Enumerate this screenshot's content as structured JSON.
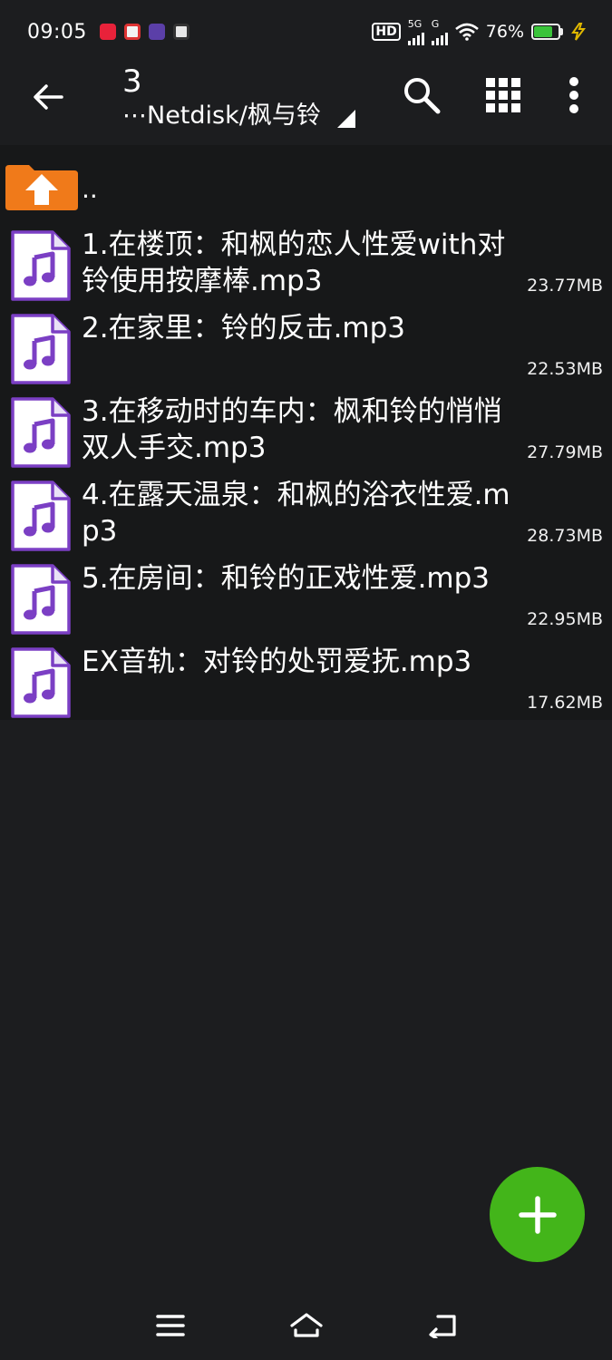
{
  "status_bar": {
    "time": "09:05",
    "network_hd": "HD",
    "network_5g": "5G",
    "network_g": "G",
    "battery_percent": "76%",
    "battery_level": 0.76,
    "battery_color": "#3ac43a"
  },
  "app_bar": {
    "title": "3",
    "path": "⋯Netdisk/枫与铃",
    "icons": [
      "back-arrow-icon",
      "search-icon",
      "grid-view-icon",
      "more-vert-icon"
    ]
  },
  "up_row": {
    "label": ".."
  },
  "files": [
    {
      "name": "1.在楼顶：和枫的恋人性爱with对铃使用按摩棒.mp3",
      "size": "23.77MB"
    },
    {
      "name": "2.在家里：铃的反击.mp3",
      "size": "22.53MB"
    },
    {
      "name": "3.在移动时的车内：枫和铃的悄悄双人手交.mp3",
      "size": "27.79MB"
    },
    {
      "name": "4.在露天温泉：和枫的浴衣性爱.mp3",
      "size": "28.73MB"
    },
    {
      "name": "5.在房间：和铃的正戏性爱.mp3",
      "size": "22.95MB"
    },
    {
      "name": "EX音轨：对铃的处罚爱抚.mp3",
      "size": "17.62MB"
    }
  ],
  "colors": {
    "background": "#1c1d1f",
    "row_background": "#171819",
    "fab": "#43b51a",
    "folder": "#f07a1a",
    "music_icon": "#7b3fc4"
  }
}
